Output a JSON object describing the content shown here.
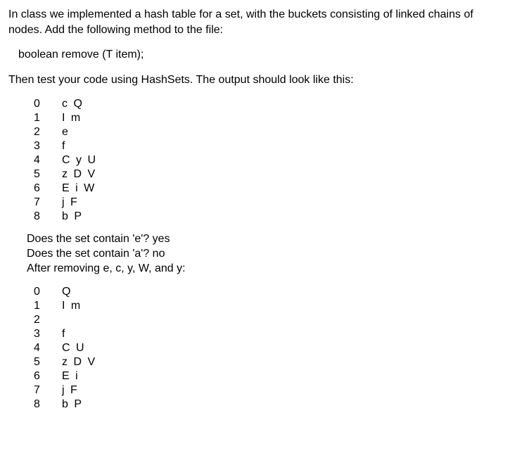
{
  "intro": "In class we implemented a hash table for a set, with the buckets consisting of linked chains of nodes.  Add the following method to the file:",
  "signature": "boolean remove (T item);",
  "instruction": "Then test your code using HashSets.  The output should look like this:",
  "table1": [
    {
      "idx": "0",
      "vals": "c Q"
    },
    {
      "idx": "1",
      "vals": "I m"
    },
    {
      "idx": "2",
      "vals": "e"
    },
    {
      "idx": "3",
      "vals": "f"
    },
    {
      "idx": "4",
      "vals": "C y U"
    },
    {
      "idx": "5",
      "vals": "z D V"
    },
    {
      "idx": "6",
      "vals": "E i W"
    },
    {
      "idx": "7",
      "vals": "j F"
    },
    {
      "idx": "8",
      "vals": "b P"
    }
  ],
  "qa": {
    "line1": "Does the set contain 'e'? yes",
    "line2": "Does the set contain 'a'? no",
    "line3": "After removing e, c, y, W, and y:"
  },
  "table2": [
    {
      "idx": "0",
      "vals": "Q"
    },
    {
      "idx": "1",
      "vals": "I m"
    },
    {
      "idx": "2",
      "vals": ""
    },
    {
      "idx": "3",
      "vals": "f"
    },
    {
      "idx": "4",
      "vals": "C U"
    },
    {
      "idx": "5",
      "vals": "z D V"
    },
    {
      "idx": "6",
      "vals": "E i"
    },
    {
      "idx": "7",
      "vals": "j F"
    },
    {
      "idx": "8",
      "vals": "b P"
    }
  ]
}
